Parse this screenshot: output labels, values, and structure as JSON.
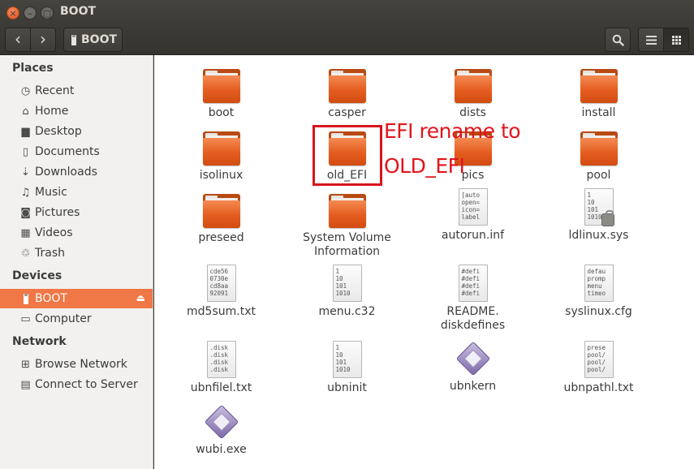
{
  "window": {
    "title": "BOOT",
    "close_glyph": "×",
    "minimize_glyph": "–",
    "maximize_glyph": "□"
  },
  "toolbar": {
    "back_glyph": "‹",
    "forward_glyph": "›",
    "path_label": "BOOT",
    "search_glyph": "⚲",
    "list_glyph": "☰",
    "grid_glyph": "⁞⁞⁞"
  },
  "sidebar": {
    "places_header": "Places",
    "places": [
      {
        "label": "Recent",
        "icon": "clock-icon",
        "glyph": "◷"
      },
      {
        "label": "Home",
        "icon": "home-icon",
        "glyph": "⌂"
      },
      {
        "label": "Desktop",
        "icon": "desktop-folder-icon",
        "glyph": "▆"
      },
      {
        "label": "Documents",
        "icon": "documents-icon",
        "glyph": "▯"
      },
      {
        "label": "Downloads",
        "icon": "download-icon",
        "glyph": "⇣"
      },
      {
        "label": "Music",
        "icon": "music-icon",
        "glyph": "♫"
      },
      {
        "label": "Pictures",
        "icon": "camera-icon",
        "glyph": "◙"
      },
      {
        "label": "Videos",
        "icon": "film-icon",
        "glyph": "▦"
      },
      {
        "label": "Trash",
        "icon": "trash-icon",
        "glyph": "♲"
      }
    ],
    "devices_header": "Devices",
    "devices": [
      {
        "label": "BOOT",
        "icon": "usb-drive-icon",
        "active": true,
        "eject_glyph": "⏏"
      },
      {
        "label": "Computer",
        "icon": "computer-icon",
        "glyph": "▭"
      }
    ],
    "network_header": "Network",
    "network": [
      {
        "label": "Browse Network",
        "icon": "network-icon",
        "glyph": "⊞"
      },
      {
        "label": "Connect to Server",
        "icon": "server-icon",
        "glyph": "▤"
      }
    ]
  },
  "files": [
    {
      "name": "boot",
      "type": "folder"
    },
    {
      "name": "casper",
      "type": "folder"
    },
    {
      "name": "dists",
      "type": "folder"
    },
    {
      "name": "install",
      "type": "folder"
    },
    {
      "name": "isolinux",
      "type": "folder"
    },
    {
      "name": "old_EFI",
      "type": "folder"
    },
    {
      "name": "pics",
      "type": "folder"
    },
    {
      "name": "pool",
      "type": "folder"
    },
    {
      "name": "preseed",
      "type": "folder"
    },
    {
      "name": "System Volume\nInformation",
      "type": "folder"
    },
    {
      "name": "autorun.inf",
      "type": "text",
      "preview": "[auto\nopen=\nicon=\nlabel"
    },
    {
      "name": "ldlinux.sys",
      "type": "binary-locked",
      "preview": "1\n10\n101\n1010"
    },
    {
      "name": "md5sum.txt",
      "type": "text",
      "preview": "cde56\n0730e\ncd8aa\n92091"
    },
    {
      "name": "menu.c32",
      "type": "binary",
      "preview": "1\n10\n101\n1010"
    },
    {
      "name": "README.\ndiskdefines",
      "type": "text",
      "preview": "#defi\n#defi\n#defi\n#defi"
    },
    {
      "name": "syslinux.cfg",
      "type": "text",
      "preview": "defau\npromp\nmenu \ntimeo"
    },
    {
      "name": "ubnfilel.txt",
      "type": "text",
      "preview": ".disk\n.disk\n.disk\n.disk"
    },
    {
      "name": "ubninit",
      "type": "binary",
      "preview": "1\n10\n101\n1010"
    },
    {
      "name": "ubnkern",
      "type": "executable"
    },
    {
      "name": "ubnpathl.txt",
      "type": "text",
      "preview": "prese\npool/\npool/\npool/"
    },
    {
      "name": "wubi.exe",
      "type": "executable"
    }
  ],
  "annotation": {
    "line1": "EFI rename to",
    "line2": "OLD_EFI",
    "color": "#e3141c"
  }
}
